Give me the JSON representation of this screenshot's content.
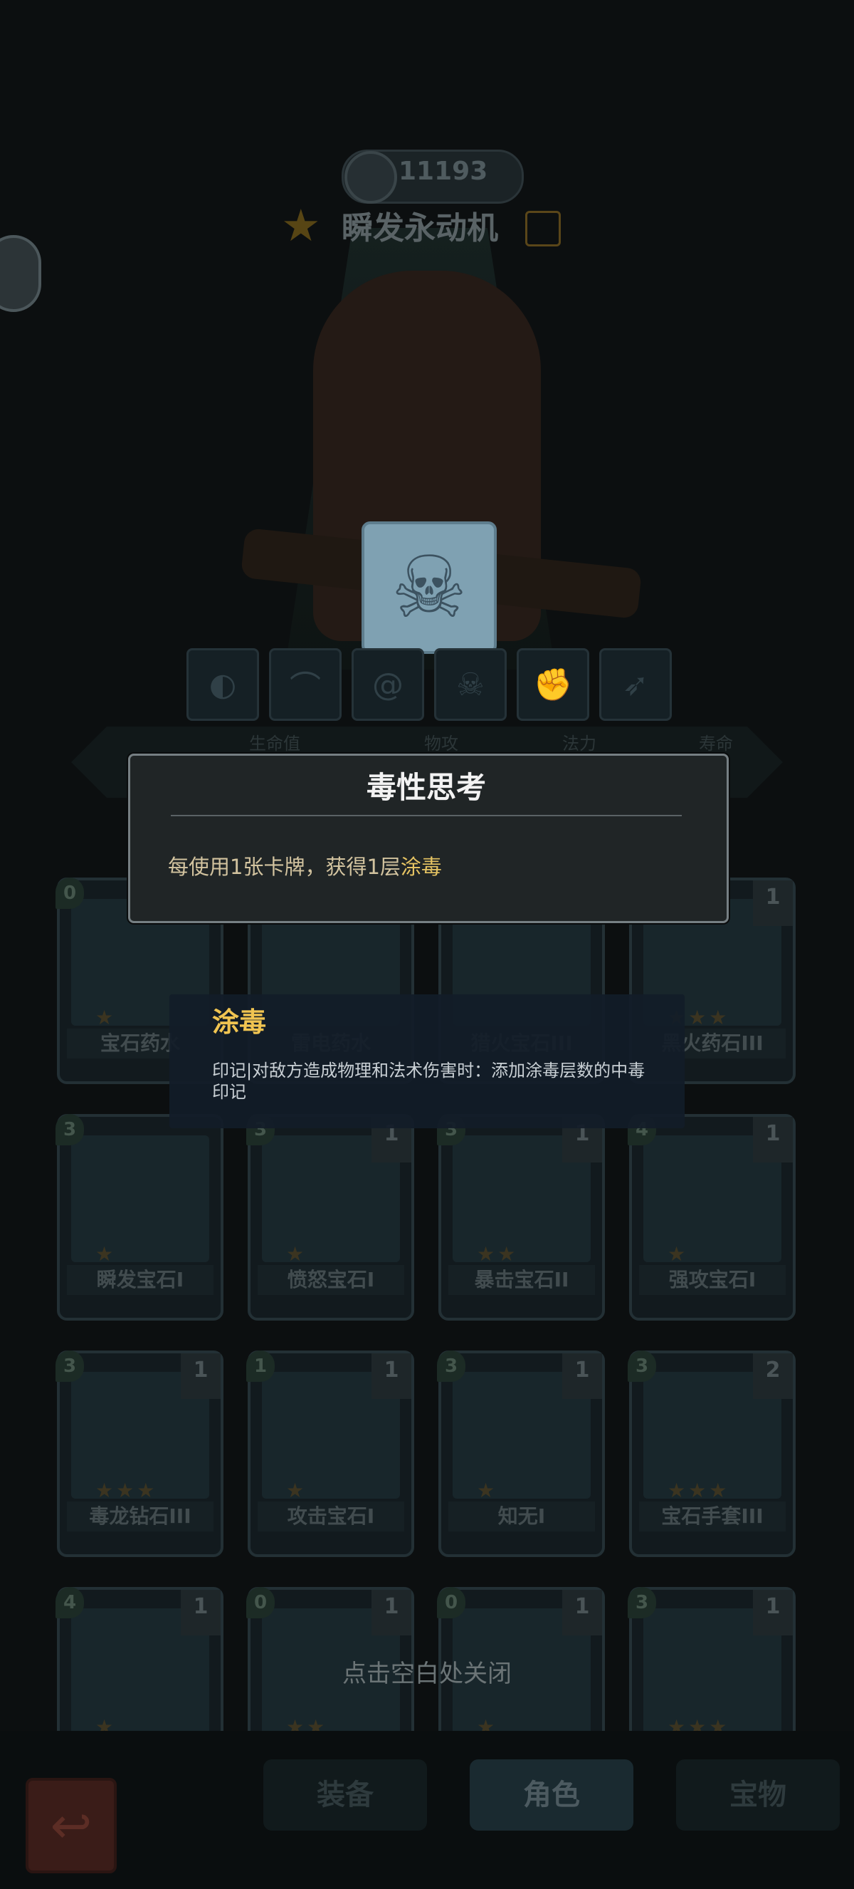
{
  "header": {
    "score": "11193",
    "character_name": "瞬发永动机"
  },
  "icons": {
    "score": "crosshair-icon",
    "star": "star-icon",
    "edit": "edit-icon",
    "poison": "skull-icon"
  },
  "skill_slots": [
    "mask-icon",
    "bow-icon",
    "swirl-icon",
    "skull-icon",
    "fist-icon",
    "feather-icon"
  ],
  "stats": {
    "labels": [
      "生命值",
      "物攻",
      "法力",
      "寿命"
    ]
  },
  "tooltip_main": {
    "title": "毒性思考",
    "desc_prefix": "每使用1张卡牌，获得1层",
    "desc_keyword": "涂毒"
  },
  "tooltip_keyword": {
    "title": "涂毒",
    "desc": "印记|对敌方造成物理和法术伤害时：添加涂毒层数的中毒印记"
  },
  "cards": [
    {
      "name": "宝石药水",
      "cost": "0",
      "level": "",
      "stars": 1
    },
    {
      "name": "雷电药水",
      "cost": "",
      "level": "",
      "stars": 0
    },
    {
      "name": "猎火宝石III",
      "cost": "",
      "level": "",
      "stars": 0
    },
    {
      "name": "黑火药石III",
      "cost": "",
      "level": "1",
      "stars": 3
    },
    {
      "name": "瞬发宝石I",
      "cost": "3",
      "level": "",
      "stars": 1
    },
    {
      "name": "愤怒宝石I",
      "cost": "3",
      "level": "1",
      "stars": 1
    },
    {
      "name": "暴击宝石II",
      "cost": "3",
      "level": "1",
      "stars": 2
    },
    {
      "name": "强攻宝石I",
      "cost": "4",
      "level": "1",
      "stars": 1
    },
    {
      "name": "毒龙钻石III",
      "cost": "3",
      "level": "1",
      "stars": 3
    },
    {
      "name": "攻击宝石I",
      "cost": "1",
      "level": "1",
      "stars": 1
    },
    {
      "name": "知无I",
      "cost": "3",
      "level": "1",
      "stars": 1
    },
    {
      "name": "宝石手套III",
      "cost": "3",
      "level": "2",
      "stars": 3
    },
    {
      "name": "",
      "cost": "4",
      "level": "1",
      "stars": 1
    },
    {
      "name": "",
      "cost": "0",
      "level": "1",
      "stars": 2
    },
    {
      "name": "",
      "cost": "0",
      "level": "1",
      "stars": 1
    },
    {
      "name": "",
      "cost": "3",
      "level": "1",
      "stars": 3
    }
  ],
  "close_hint": "点击空白处关闭",
  "bottom_nav": {
    "tabs": [
      "装备",
      "角色",
      "宝物"
    ],
    "active": "角色",
    "back_icon": "return-arrow-icon"
  }
}
